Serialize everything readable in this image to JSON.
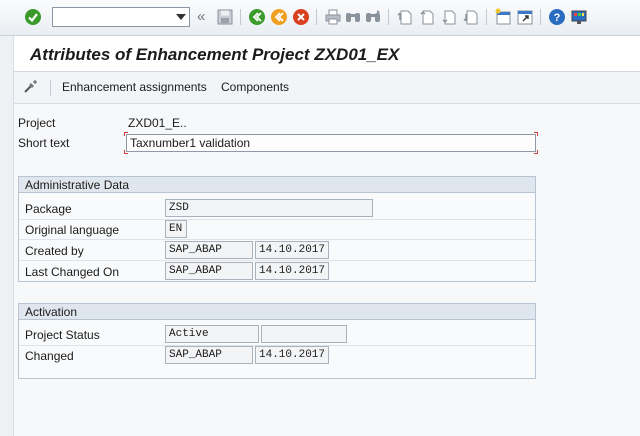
{
  "toolbar": {
    "command_field": "",
    "icons": [
      "check-icon",
      "save-icon",
      "back-icon",
      "exit-icon",
      "cancel-icon",
      "print-icon",
      "find-icon",
      "find-next-icon",
      "first-page-icon",
      "previous-page-icon",
      "next-page-icon",
      "last-page-icon",
      "create-session-icon",
      "shortcut-icon",
      "help-icon",
      "customize-layout-icon"
    ],
    "double_chevron": "«"
  },
  "title": "Attributes of Enhancement Project ZXD01_EX",
  "appbar": {
    "enh_assignments": "Enhancement assignments",
    "components": "Components"
  },
  "header_fields": {
    "project_label": "Project",
    "project_value": "ZXD01_E..",
    "short_text_label": "Short text",
    "short_text_value": "Taxnumber1 validation"
  },
  "admin": {
    "title": "Administrative Data",
    "package_label": "Package",
    "package_value": "ZSD",
    "language_label": "Original language",
    "language_value": "EN",
    "created_label": "Created by",
    "created_user": "SAP_ABAP",
    "created_date": "14.10.2017",
    "changed_label": "Last Changed On",
    "changed_user": "SAP_ABAP",
    "changed_date": "14.10.2017"
  },
  "activation": {
    "title": "Activation",
    "status_label": "Project Status",
    "status_value": "Active",
    "status_extra": "",
    "changed_label": "Changed",
    "changed_user": "SAP_ABAP",
    "changed_date": "14.10.2017"
  },
  "colors": {
    "ok_green": "#3a9a2a",
    "exit_orange": "#f0a020",
    "cancel_red": "#d9401f",
    "help_blue": "#2a6cc0"
  }
}
